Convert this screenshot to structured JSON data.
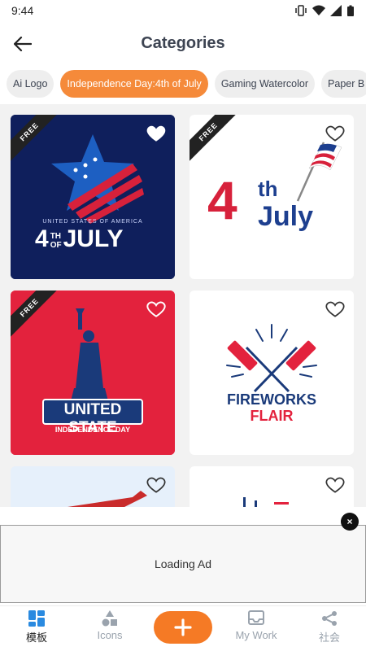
{
  "status": {
    "time": "9:44"
  },
  "header": {
    "title": "Categories"
  },
  "chips": [
    {
      "label": "Ai Logo"
    },
    {
      "label": "Independence Day:4th of July"
    },
    {
      "label": "Gaming Watercolor"
    },
    {
      "label": "Paper B"
    }
  ],
  "cards": [
    {
      "badge": "FREE",
      "lines": [
        "UNITED STATES OF AMERICA",
        "4",
        "TH",
        "OF",
        "JULY"
      ]
    },
    {
      "badge": "FREE",
      "lines": [
        "4",
        "th",
        "July"
      ]
    },
    {
      "badge": "FREE",
      "lines": [
        "UNITED STATE",
        "INDEPENDENCE DAY"
      ]
    },
    {
      "lines": [
        "FIREWORKS",
        "FLAIR"
      ]
    }
  ],
  "ad": {
    "text": "Loading Ad",
    "close": "×"
  },
  "nav": {
    "templates": "模板",
    "icons": "Icons",
    "mywork": "My Work",
    "community": "社会"
  },
  "colors": {
    "accent": "#f58a3a",
    "navy": "#0f1f5c",
    "red": "#d7213b"
  }
}
